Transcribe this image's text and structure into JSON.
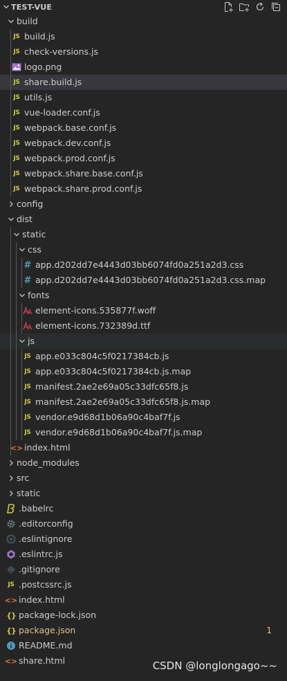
{
  "explorer": {
    "title": "TEST-VUE",
    "actions": [
      "new-file-icon",
      "new-folder-icon",
      "refresh-icon",
      "collapse-all-icon"
    ]
  },
  "tree": [
    {
      "label": "build",
      "type": "folder",
      "open": true,
      "depth": 0
    },
    {
      "label": "build.js",
      "type": "js",
      "depth": 1
    },
    {
      "label": "check-versions.js",
      "type": "js",
      "depth": 1
    },
    {
      "label": "logo.png",
      "type": "image",
      "depth": 1
    },
    {
      "label": "share.build.js",
      "type": "js",
      "depth": 1,
      "state": "selected"
    },
    {
      "label": "utils.js",
      "type": "js",
      "depth": 1
    },
    {
      "label": "vue-loader.conf.js",
      "type": "js",
      "depth": 1
    },
    {
      "label": "webpack.base.conf.js",
      "type": "js",
      "depth": 1
    },
    {
      "label": "webpack.dev.conf.js",
      "type": "js",
      "depth": 1
    },
    {
      "label": "webpack.prod.conf.js",
      "type": "js",
      "depth": 1
    },
    {
      "label": "webpack.share.base.conf.js",
      "type": "js",
      "depth": 1
    },
    {
      "label": "webpack.share.prod.conf.js",
      "type": "js",
      "depth": 1
    },
    {
      "label": "config",
      "type": "folder",
      "open": false,
      "depth": 0
    },
    {
      "label": "dist",
      "type": "folder",
      "open": true,
      "depth": 0
    },
    {
      "label": "static",
      "type": "folder",
      "open": true,
      "depth": 1
    },
    {
      "label": "css",
      "type": "folder",
      "open": true,
      "depth": 2
    },
    {
      "label": "app.d202dd7e4443d03bb6074fd0a251a2d3.css",
      "type": "css",
      "depth": 3
    },
    {
      "label": "app.d202dd7e4443d03bb6074fd0a251a2d3.css.map",
      "type": "css",
      "depth": 3
    },
    {
      "label": "fonts",
      "type": "folder",
      "open": true,
      "depth": 2
    },
    {
      "label": "element-icons.535877f.woff",
      "type": "font",
      "depth": 3
    },
    {
      "label": "element-icons.732389d.ttf",
      "type": "font",
      "depth": 3
    },
    {
      "label": "js",
      "type": "folder",
      "open": true,
      "depth": 2,
      "state": "focused"
    },
    {
      "label": "app.e033c804c5f0217384cb.js",
      "type": "js",
      "depth": 3
    },
    {
      "label": "app.e033c804c5f0217384cb.js.map",
      "type": "js",
      "depth": 3
    },
    {
      "label": "manifest.2ae2e69a05c33dfc65f8.js",
      "type": "js",
      "depth": 3
    },
    {
      "label": "manifest.2ae2e69a05c33dfc65f8.js.map",
      "type": "js",
      "depth": 3
    },
    {
      "label": "vendor.e9d68d1b06a90c4baf7f.js",
      "type": "js",
      "depth": 3
    },
    {
      "label": "vendor.e9d68d1b06a90c4baf7f.js.map",
      "type": "js",
      "depth": 3
    },
    {
      "label": "index.html",
      "type": "html",
      "depth": 1
    },
    {
      "label": "node_modules",
      "type": "folder",
      "open": false,
      "depth": 0
    },
    {
      "label": "src",
      "type": "folder",
      "open": false,
      "depth": 0
    },
    {
      "label": "static",
      "type": "folder",
      "open": false,
      "depth": 0
    },
    {
      "label": ".babelrc",
      "type": "babel",
      "depth": 0
    },
    {
      "label": ".editorconfig",
      "type": "gear",
      "depth": 0
    },
    {
      "label": ".eslintignore",
      "type": "eslintignore",
      "depth": 0
    },
    {
      "label": ".eslintrc.js",
      "type": "eslint",
      "depth": 0
    },
    {
      "label": ".gitignore",
      "type": "git",
      "depth": 0
    },
    {
      "label": ".postcssrc.js",
      "type": "js",
      "depth": 0
    },
    {
      "label": "index.html",
      "type": "html",
      "depth": 0
    },
    {
      "label": "package-lock.json",
      "type": "json",
      "depth": 0
    },
    {
      "label": "package.json",
      "type": "json",
      "depth": 0,
      "modified": true,
      "badge": "1"
    },
    {
      "label": "README.md",
      "type": "info",
      "depth": 0
    },
    {
      "label": "share.html",
      "type": "html",
      "depth": 0
    }
  ],
  "watermark": "CSDN @longlongago~~",
  "colors": {
    "background": "#252526",
    "selected": "#37373d",
    "text": "#cccccc",
    "js": "#cbcb41",
    "css": "#519aba",
    "html": "#e37933",
    "modified": "#e2c08d"
  }
}
